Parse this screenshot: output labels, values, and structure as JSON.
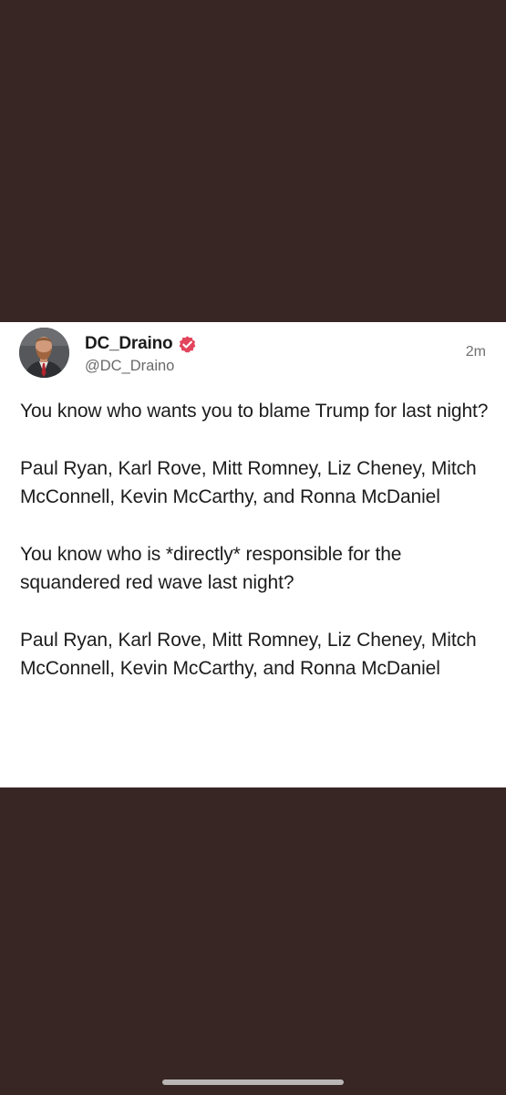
{
  "post": {
    "author": {
      "display_name": "DC_Draino",
      "handle": "@DC_Draino",
      "verified": true,
      "verified_color": "#e2445c",
      "avatar_icon": "profile-photo"
    },
    "timestamp": "2m",
    "paragraphs": [
      "You know who wants you to blame Trump for last night?",
      "Paul Ryan, Karl Rove, Mitt Romney, Liz Cheney, Mitch McConnell, Kevin McCarthy, and Ronna McDaniel",
      "You know who is *directly* responsible for the squandered red wave last night?",
      "Paul Ryan, Karl Rove, Mitt Romney, Liz Cheney, Mitch McConnell, Kevin McCarthy, and Ronna McDaniel"
    ]
  },
  "colors": {
    "background": "#372624",
    "card": "#ffffff",
    "text": "#1c1c1c",
    "muted": "#6a6a6a"
  }
}
